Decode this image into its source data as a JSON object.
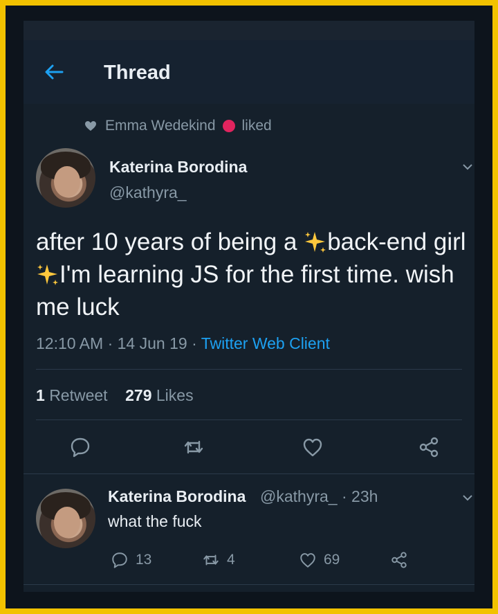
{
  "header": {
    "title": "Thread"
  },
  "social_context": {
    "user": "Emma Wedekind",
    "action": "liked"
  },
  "tweet": {
    "author_name": "Katerina Borodina",
    "author_handle": "@kathyra_",
    "text_part1": "after 10 years of being a ",
    "text_part2": "back-end girl",
    "text_part3": "I'm learning JS for the first time. wish me luck",
    "time": "12:10 AM",
    "date": "14 Jun 19",
    "client": "Twitter Web Client",
    "retweets_count": "1",
    "retweets_label": "Retweet",
    "likes_count": "279",
    "likes_label": "Likes"
  },
  "reply": {
    "author_name": "Katerina Borodina",
    "author_handle": "@kathyra_",
    "time": "23h",
    "text": "what the fuck",
    "reply_count": "13",
    "retweet_count": "4",
    "like_count": "69"
  },
  "icons": {
    "back": "arrow-left-icon",
    "heart": "heart-icon",
    "reply": "reply-icon",
    "retweet": "retweet-icon",
    "like": "like-icon",
    "share": "share-icon",
    "sparkles": "sparkles-icon",
    "chevron": "chevron-down-icon"
  },
  "colors": {
    "accent": "#1da1f2",
    "background": "#15202b",
    "frame": "#f2c200",
    "muted": "#8899a6"
  }
}
